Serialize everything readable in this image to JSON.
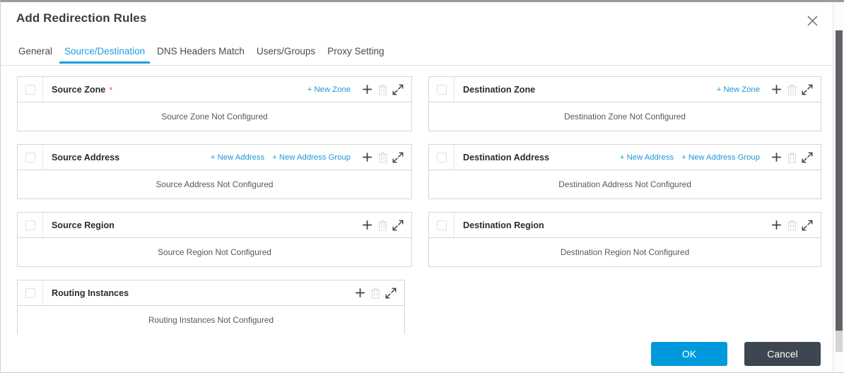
{
  "dialog": {
    "title": "Add Redirection Rules",
    "close_icon": "close-icon"
  },
  "tabs": [
    {
      "label": "General",
      "active": false
    },
    {
      "label": "Source/Destination",
      "active": true
    },
    {
      "label": "DNS Headers Match",
      "active": false
    },
    {
      "label": "Users/Groups",
      "active": false
    },
    {
      "label": "Proxy Setting",
      "active": false
    }
  ],
  "panels": [
    {
      "id": "source-zone",
      "title": "Source Zone",
      "required": true,
      "required_mark": "*",
      "links": [
        "+ New Zone"
      ],
      "empty_text": "Source Zone Not Configured",
      "column": "left"
    },
    {
      "id": "destination-zone",
      "title": "Destination Zone",
      "required": false,
      "required_mark": "",
      "links": [
        "+ New Zone"
      ],
      "empty_text": "Destination Zone Not Configured",
      "column": "right"
    },
    {
      "id": "source-address",
      "title": "Source Address",
      "required": false,
      "required_mark": "",
      "links": [
        "+ New Address",
        "+ New Address Group"
      ],
      "empty_text": "Source Address Not Configured",
      "column": "left"
    },
    {
      "id": "destination-address",
      "title": "Destination Address",
      "required": false,
      "required_mark": "",
      "links": [
        "+ New Address",
        "+ New Address Group"
      ],
      "empty_text": "Destination Address Not Configured",
      "column": "right"
    },
    {
      "id": "source-region",
      "title": "Source Region",
      "required": false,
      "required_mark": "",
      "links": [],
      "empty_text": "Source Region Not Configured",
      "column": "left"
    },
    {
      "id": "destination-region",
      "title": "Destination Region",
      "required": false,
      "required_mark": "",
      "links": [],
      "empty_text": "Destination Region Not Configured",
      "column": "right"
    },
    {
      "id": "routing-instances",
      "title": "Routing Instances",
      "required": false,
      "required_mark": "",
      "links": [],
      "empty_text": "Routing Instances Not Configured",
      "column": "narrow"
    }
  ],
  "panel_icons": {
    "add": "plus-icon",
    "delete": "trash-icon",
    "expand": "expand-icon"
  },
  "footer": {
    "ok_label": "OK",
    "cancel_label": "Cancel"
  },
  "colors": {
    "accent_blue": "#0099dc",
    "link_blue": "#1e97d6",
    "tab_active": "#1ba0e2",
    "cancel_dark": "#3e4651",
    "required_red": "#f2576e"
  }
}
